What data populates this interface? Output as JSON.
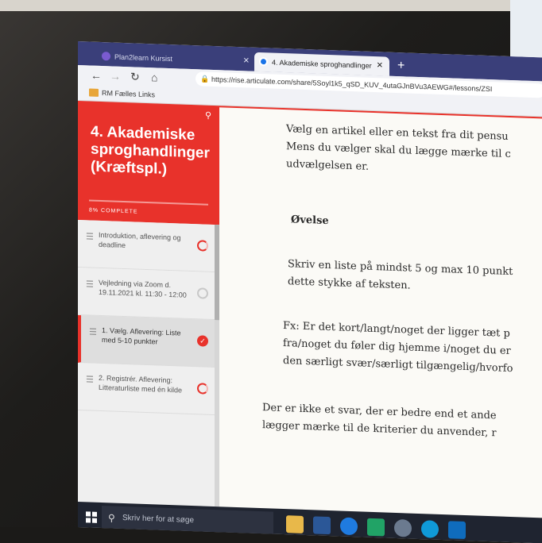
{
  "browser": {
    "tabs": [
      {
        "label": "Plan2learn Kursist"
      },
      {
        "label": "4. Akademiske sproghandlinger"
      }
    ],
    "new_tab_label": "+",
    "url": "https://rise.articulate.com/share/5Soyl1k5_qSD_KUV_4utaGJnBVu3AEWG#/lessons/ZSI",
    "bookmark": "RM Fælles Links"
  },
  "sidebar": {
    "course_title": "4. Akademiske sproghandlinger (Kræftspl.)",
    "progress_text": "8% COMPLETE",
    "lessons": [
      {
        "label": "Introduktion, aflevering og deadline",
        "status": "in-progress"
      },
      {
        "label": "Vejledning via Zoom d. 19.11.2021 kl. 11:30 - 12:00",
        "status": "not-started"
      },
      {
        "label": "1. Vælg. Aflevering: Liste med 5-10 punkter",
        "status": "complete"
      },
      {
        "label": "2. Registrér. Aflevering: Litteraturliste med én kilde",
        "status": "in-progress"
      }
    ]
  },
  "content": {
    "intro_lines": [
      "Vælg en artikel eller en tekst fra dit pensu",
      "Mens du vælger skal du lægge mærke til c",
      "udvælgelsen er."
    ],
    "heading": "Øvelse",
    "exercise_lines": [
      "Skriv en liste på mindst 5 og max 10 punkt",
      "dette stykke af teksten."
    ],
    "example_lines": [
      "Fx: Er det kort/langt/noget der ligger tæt p",
      "fra/noget du føler dig hjemme i/noget du er",
      "den særligt svær/særligt tilgængelig/hvorfo"
    ],
    "closing_lines": [
      "Der er ikke et svar, der er bedre end et ande",
      "lægger mærke til de kriterier du anvender, r"
    ]
  },
  "taskbar": {
    "search_placeholder": "Skriv her for at søge"
  },
  "colors": {
    "accent": "#e8322b",
    "tabstrip": "#3a3f7a",
    "taskbar": "#1f2430"
  }
}
